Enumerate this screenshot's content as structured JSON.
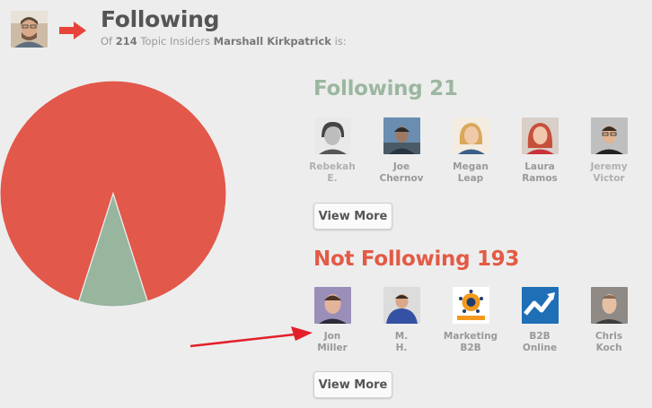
{
  "header": {
    "title": "Following",
    "subtitle_prefix": "Of",
    "insider_count": "214",
    "subtitle_middle": "Topic Insiders",
    "person_name": "Marshall Kirkpatrick",
    "subtitle_suffix": "is:"
  },
  "colors": {
    "following": "#9cb7a0",
    "not_following": "#e35a45",
    "pie_following": "#98b59e",
    "pie_not_following": "#e2584a"
  },
  "pie": {
    "following": 21,
    "not_following": 193
  },
  "following": {
    "heading": "Following 21",
    "people": [
      {
        "first": "Rebekah",
        "last": "E."
      },
      {
        "first": "Joe",
        "last": "Chernov"
      },
      {
        "first": "Megan",
        "last": "Leap"
      },
      {
        "first": "Laura",
        "last": "Ramos"
      },
      {
        "first": "Jeremy",
        "last": "Victor"
      }
    ],
    "view_more": "View More"
  },
  "not_following": {
    "heading": "Not Following 193",
    "people": [
      {
        "first": "Jon",
        "last": "Miller"
      },
      {
        "first": "M.",
        "last": "H."
      },
      {
        "first": "Marketing",
        "last": "B2B"
      },
      {
        "first": "B2B",
        "last": "Online"
      },
      {
        "first": "Chris",
        "last": "Koch"
      }
    ],
    "view_more": "View More"
  },
  "icons": {
    "header_arrow": "right-arrow-icon",
    "annotation_arrow": "annotation-arrow-icon"
  }
}
